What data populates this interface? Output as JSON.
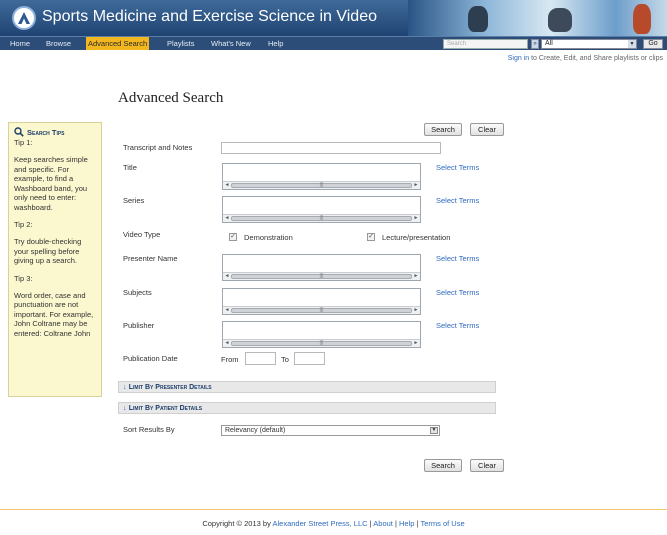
{
  "header": {
    "site_title": "Sports Medicine and Exercise Science in Video",
    "search_placeholder": "Search",
    "scope_selected": "All",
    "go_label": "Go"
  },
  "nav": {
    "items": [
      {
        "label": "Home"
      },
      {
        "label": "Browse"
      },
      {
        "label": "Advanced Search"
      },
      {
        "label": "Playlists"
      },
      {
        "label": "What's New"
      },
      {
        "label": "Help"
      }
    ],
    "active": "Advanced Search"
  },
  "signin": {
    "link": "Sign in",
    "text": " to Create, Edit, and Share playlists or clips"
  },
  "tips": {
    "title": "Search Tips",
    "tip1_label": "Tip 1:",
    "tip1_text": "Keep searches simple and specific. For example, to find a Washboard band, you only need to enter: washboard.",
    "tip2_label": "Tip 2:",
    "tip2_text": "Try double-checking your spelling before giving up a search.",
    "tip3_label": "Tip 3:",
    "tip3_text": "Word order, case and punctuation are not important. For example, John Coltrane may be entered: Coltrane John"
  },
  "form": {
    "page_title": "Advanced Search",
    "search_label": "Search",
    "clear_label": "Clear",
    "transcript_label": "Transcript and Notes",
    "title_label": "Title",
    "series_label": "Series",
    "video_type_label": "Video Type",
    "type_demonstration": "Demonstration",
    "type_lecture": "Lecture/presentation",
    "presenter_label": "Presenter Name",
    "subjects_label": "Subjects",
    "publisher_label": "Publisher",
    "pubdate_label": "Publication Date",
    "from_label": "From",
    "to_label": "To",
    "select_terms": "Select Terms",
    "limit_presenter": "Limit By Presenter Details",
    "limit_patient": "Limit By Patient Details",
    "sort_label": "Sort Results By",
    "sort_selected": "Relevancy (default)"
  },
  "footer": {
    "copyright_prefix": "Copyright © 2013 by ",
    "company": "Alexander Street Press, LLC",
    "about": "About",
    "help": "Help",
    "terms": "Terms of Use"
  },
  "colors": {
    "header_blue": "#2b4d78",
    "nav_active": "#f2b71e",
    "link_blue": "#2f6bbf",
    "tips_bg": "#fbf7cf"
  }
}
